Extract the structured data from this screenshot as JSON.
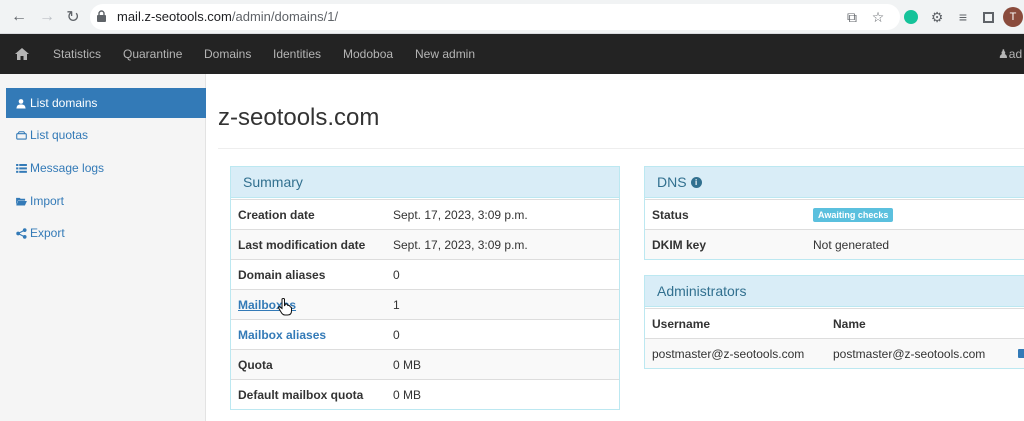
{
  "browser": {
    "url_host": "mail.z-seotools.com",
    "url_path": "/admin/domains/1/",
    "avatar_letter": "T"
  },
  "topnav": {
    "items": [
      "Statistics",
      "Quarantine",
      "Domains",
      "Identities",
      "Modoboa",
      "New admin"
    ],
    "user": "ad"
  },
  "sidebar": {
    "items": [
      {
        "label": "List domains",
        "icon": "user-icon",
        "active": true
      },
      {
        "label": "List quotas",
        "icon": "hdd-icon",
        "active": false
      },
      {
        "label": "Message logs",
        "icon": "list-icon",
        "active": false
      },
      {
        "label": "Import",
        "icon": "folder-open-icon",
        "active": false
      },
      {
        "label": "Export",
        "icon": "share-icon",
        "active": false
      }
    ]
  },
  "main": {
    "title": "z-seotools.com"
  },
  "summary": {
    "heading": "Summary",
    "rows": [
      {
        "key": "Creation date",
        "value": "Sept. 17, 2023, 3:09 p.m."
      },
      {
        "key": "Last modification date",
        "value": "Sept. 17, 2023, 3:09 p.m."
      },
      {
        "key": "Domain aliases",
        "value": "0"
      },
      {
        "key": "Mailboxes",
        "value": "1"
      },
      {
        "key": "Mailbox aliases",
        "value": "0"
      },
      {
        "key": "Quota",
        "value": "0 MB"
      },
      {
        "key": "Default mailbox quota",
        "value": "0 MB"
      }
    ]
  },
  "dns": {
    "heading": "DNS",
    "status_label": "Status",
    "status_badge": "Awaiting checks",
    "dkim_label": "DKIM key",
    "dkim_value": "Not generated"
  },
  "administrators": {
    "heading": "Administrators",
    "col_username": "Username",
    "col_name": "Name",
    "rows": [
      {
        "username": "postmaster@z-seotools.com",
        "name": "postmaster@z-seotools.com"
      }
    ]
  },
  "colors": {
    "accent": "#337ab7",
    "panel_heading_bg": "#d9edf7",
    "panel_heading_text": "#31708f",
    "badge": "#5bc0de",
    "navbar": "#232323"
  }
}
